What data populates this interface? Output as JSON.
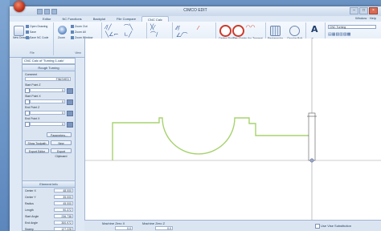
{
  "window": {
    "title": "CIMCO EDIT",
    "controls": [
      "–",
      "□",
      "×"
    ]
  },
  "ribbon": {
    "tabs": [
      "Editor",
      "NC Functions",
      "Backplot",
      "File Compare",
      "CNC Calc"
    ],
    "active_tab_index": 4,
    "help_label": "Window · Help",
    "groups": {
      "file": {
        "label": "File",
        "items": [
          "Open Drawing",
          "Save",
          "Save NC Code"
        ],
        "new_label": "New Drawing"
      },
      "view": {
        "label": "View",
        "items": [
          "Zoom Out",
          "Zoom All",
          "Zoom Window"
        ],
        "zoom_label": "Zoom"
      },
      "geometry": {
        "label": "Geometry"
      },
      "trim": {
        "label": "Trim"
      },
      "show_hide": {
        "label": "Show/Hide"
      },
      "centre_arc": {
        "label": "Centre / Arc / Circle",
        "items": [
          "Centre Radius",
          "Two Points",
          "Arc Tangent"
        ]
      },
      "markers": {
        "label": "Markers",
        "items": [
          "Rectangular Bolt Hole",
          "Circular Bolt Hole"
        ]
      },
      "text": {
        "label": "Text"
      },
      "turning": {
        "label": "Turning Operations",
        "select_value": "CNC Turning"
      }
    }
  },
  "document_tab": "CNC Calc of 'Turning 1.calc'",
  "left_panel": {
    "header": "Rough Turning",
    "comment_label": "Comment",
    "comment_value": "FINISHED",
    "start_point_z_label": "Start Point Z",
    "start_point_x_label": "Start Point X",
    "end_point_z_label": "End Point Z",
    "end_point_x_label": "End Point X",
    "values": [
      "0",
      "0",
      "0",
      "0"
    ],
    "parameters_button": "Parameters...",
    "show_toolpath_button": "Show Toolpath",
    "new_button": "New",
    "export_editor_button": "Export Editor",
    "export_clipboard_button": "Export Clipboard",
    "element_info": {
      "header": "Element Info",
      "rows": [
        {
          "label": "Center X",
          "value": "48.000"
        },
        {
          "label": "Center Y",
          "value": "35.000"
        },
        {
          "label": "Radius",
          "value": "45.000"
        },
        {
          "label": "Length",
          "value": "90.372"
        },
        {
          "label": "Start Angle",
          "value": "236.738"
        },
        {
          "label": "End Angle",
          "value": "300.972"
        },
        {
          "label": "Sweep",
          "value": "127.228"
        }
      ]
    }
  },
  "bottom_bar": {
    "machine_zero_x": "Machine Zero X",
    "machine_zero_z": "Machine Zero Z",
    "x_value": "0.0",
    "z_value": "0.0",
    "use_vise_label": "Use Vise Substitution"
  },
  "colors": {
    "profile": "#9ccf6a",
    "axis": "#8a8a8a",
    "accent": "#c0301a"
  }
}
